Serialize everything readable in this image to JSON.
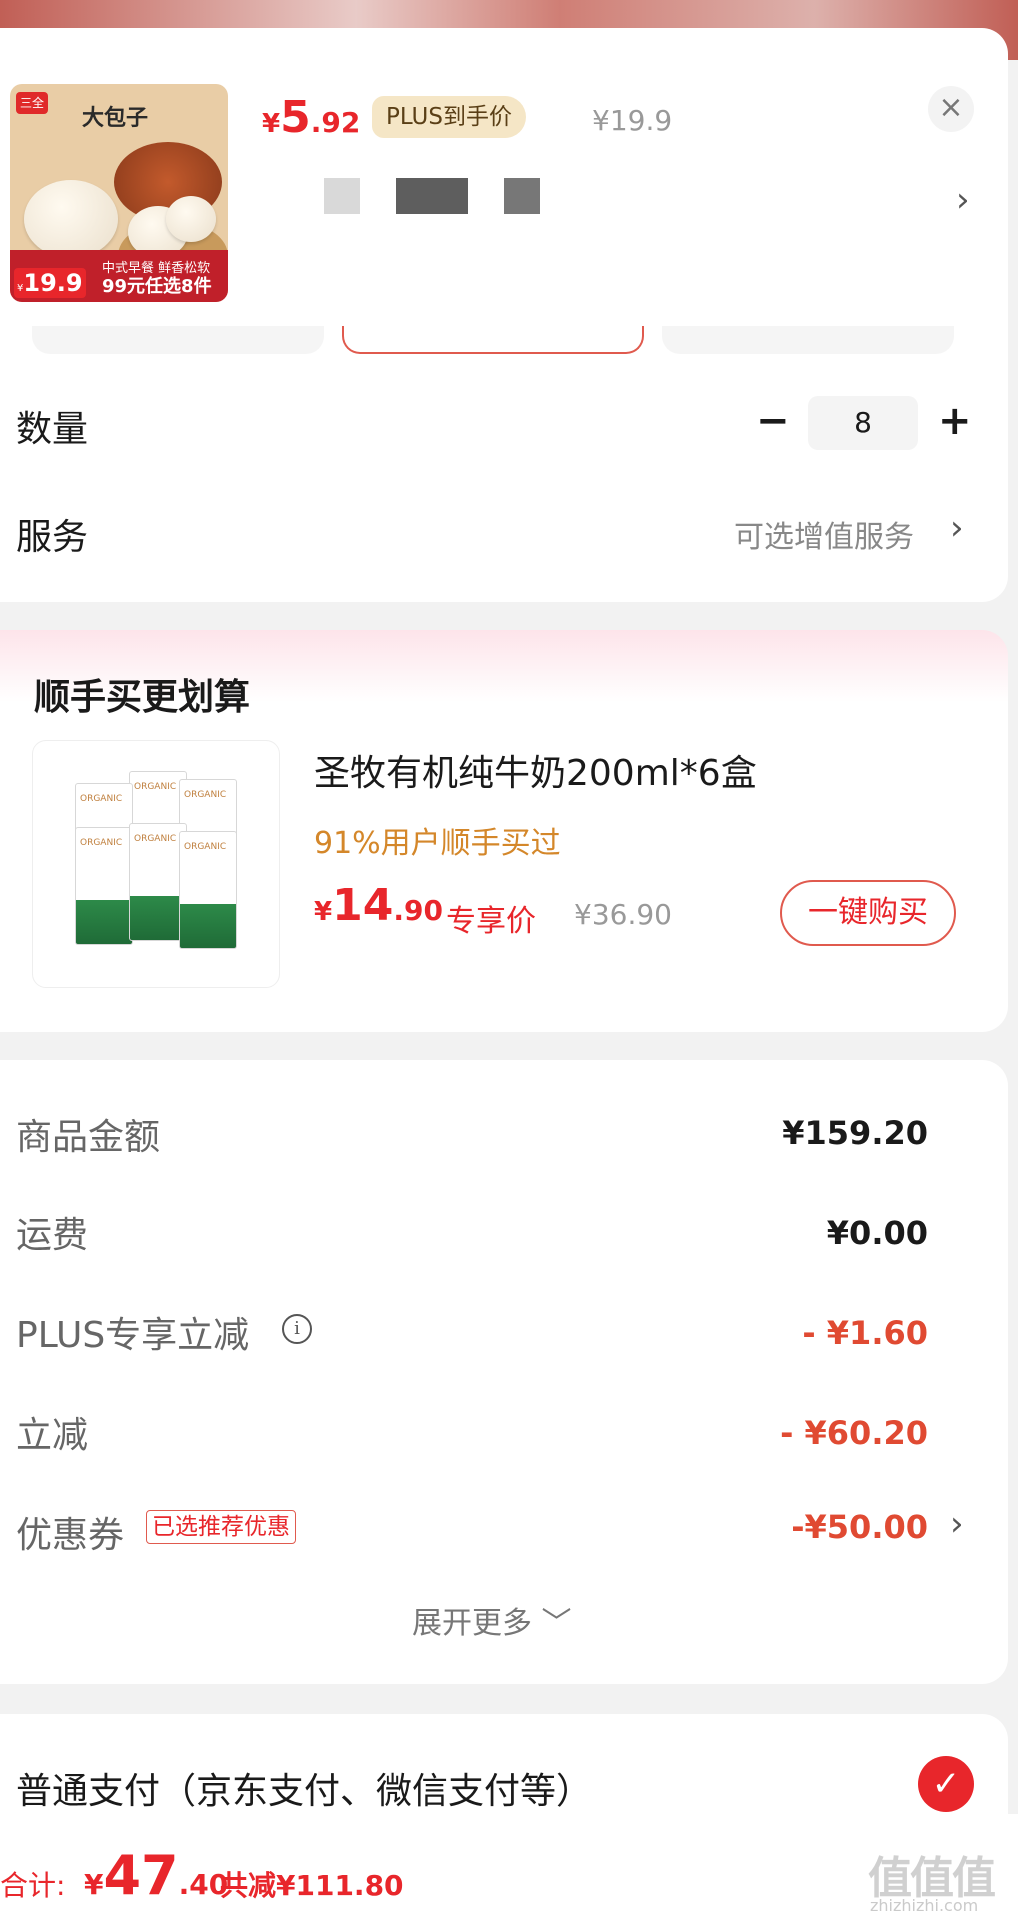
{
  "product": {
    "image_title": "大包子",
    "image_logo": "三全",
    "image_price_tag_prefix": "¥",
    "image_price_tag": "19.9",
    "image_band_line1": "中式早餐 鲜香松软",
    "image_band_line2": "99元任选8件",
    "price_yen": "¥",
    "price_int": "5",
    "price_dec": ".92",
    "plus_badge": "PLUS到手价",
    "original_price": "¥19.9"
  },
  "quantity": {
    "label": "数量",
    "value": "8",
    "minus": "−",
    "plus": "+"
  },
  "service": {
    "label": "服务",
    "value": "可选增值服务"
  },
  "upsell": {
    "title": "顺手买更划算",
    "item": {
      "name": "圣牧有机纯牛奶200ml*6盒",
      "bought_text": "91%用户顺手买过",
      "price_yen": "¥",
      "price_int": "14",
      "price_dec": ".90",
      "exclusive": "专享价",
      "original_price": "¥36.90",
      "buy_button": "一键购买",
      "box_label": "ORGANIC"
    }
  },
  "summary": {
    "rows": [
      {
        "label": "商品金额",
        "value": "¥159.20"
      },
      {
        "label": "运费",
        "value": "¥0.00"
      },
      {
        "label": "PLUS专享立减",
        "value": "- ¥1.60"
      },
      {
        "label": "立减",
        "value": "- ¥60.20"
      },
      {
        "label": "优惠券",
        "value": "-¥50.00"
      }
    ],
    "coupon_tag": "已选推荐优惠",
    "expand": "展开更多",
    "expand_icon": "﹀"
  },
  "payment": {
    "label": "普通支付（京东支付、微信支付等）",
    "check": "✓"
  },
  "total": {
    "label": "合计:",
    "yen": "¥",
    "int": "47",
    "dec": ".40",
    "saved": "共减¥111.80"
  },
  "icons": {
    "close": "×",
    "chevron": "›",
    "info": "i"
  },
  "watermark": {
    "main": "值值值",
    "sub": "zhizhizhi.com"
  },
  "colors": {
    "accent": "#e8262b",
    "plus_gold": "#f5e6c6",
    "muted": "#999999"
  }
}
